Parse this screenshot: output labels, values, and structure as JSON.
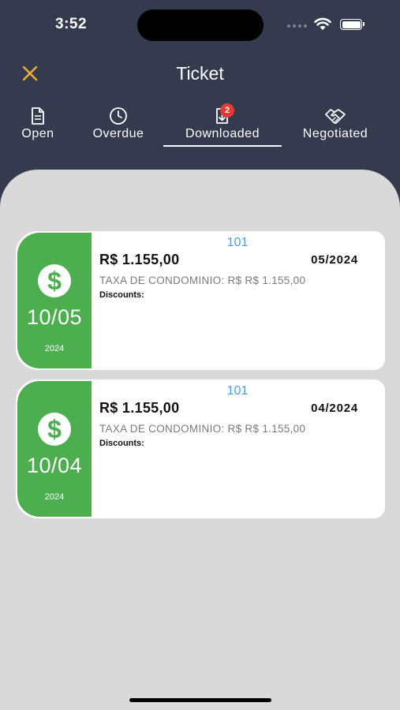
{
  "status_bar": {
    "time": "3:52"
  },
  "header": {
    "title": "Ticket",
    "close_icon": "close-icon",
    "accent_color": "#f3b12d"
  },
  "tabs": [
    {
      "label": "Open",
      "icon": "document-icon",
      "active": false
    },
    {
      "label": "Overdue",
      "icon": "clock-icon",
      "active": false
    },
    {
      "label": "Downloaded",
      "icon": "download-icon",
      "active": true,
      "badge": "2"
    },
    {
      "label": "Negotiated",
      "icon": "handshake-icon",
      "active": false
    }
  ],
  "tickets": [
    {
      "day": "10/05",
      "year": "2024",
      "unit": "101",
      "amount": "R$ 1.155,00",
      "period": "05/2024",
      "description": "TAXA DE CONDOMINIO: R$ R$ 1.155,00",
      "discounts_label": "Discounts:"
    },
    {
      "day": "10/04",
      "year": "2024",
      "unit": "101",
      "amount": "R$ 1.155,00",
      "period": "04/2024",
      "description": "TAXA DE CONDOMINIO: R$ R$ 1.155,00",
      "discounts_label": "Discounts:"
    }
  ],
  "colors": {
    "header_bg": "#363a4f",
    "ticket_green": "#4cae4f",
    "unit_blue": "#47a3e8",
    "badge_red": "#e53935"
  }
}
